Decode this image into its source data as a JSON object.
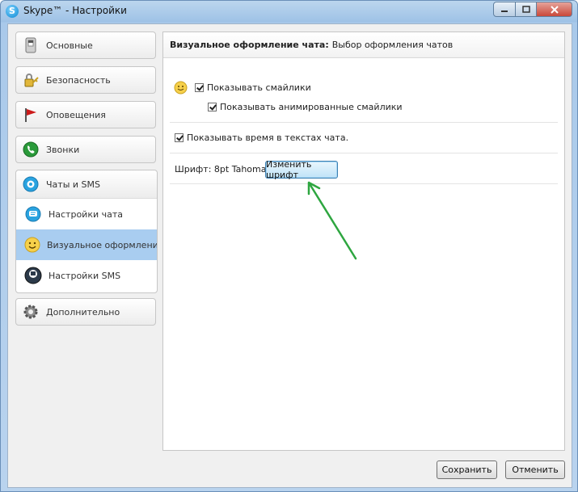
{
  "window": {
    "title": "Skype™ - Настройки",
    "app_icon_letter": "S"
  },
  "sidebar": {
    "items": [
      {
        "label": "Основные",
        "icon": "switch-icon"
      },
      {
        "label": "Безопасность",
        "icon": "lock-key-icon"
      },
      {
        "label": "Оповещения",
        "icon": "flag-icon"
      },
      {
        "label": "Звонки",
        "icon": "phone-icon"
      }
    ],
    "group": {
      "label": "Чаты и SMS",
      "icon": "chat-bubble-icon",
      "subitems": [
        {
          "label": "Настройки чата",
          "icon": "chat-settings-icon"
        },
        {
          "label": "Визуальное оформление чата",
          "icon": "smiley-icon",
          "active": true
        },
        {
          "label": "Настройки SMS",
          "icon": "sms-phone-icon"
        }
      ]
    },
    "advanced": {
      "label": "Дополнительно",
      "icon": "gear-icon"
    }
  },
  "panel": {
    "header_bold": "Визуальное оформление чата:",
    "header_text": "Выбор оформления чатов",
    "show_smileys": {
      "label": "Показывать смайлики",
      "checked": true
    },
    "show_animated": {
      "label": "Показывать анимированные смайлики",
      "checked": true
    },
    "show_time": {
      "label": "Показывать время в текстах чата.",
      "checked": true
    },
    "font_label": "Шрифт: 8pt Tahoma",
    "change_font_button": "Изменить шрифт"
  },
  "footer": {
    "save_button": "Сохранить",
    "cancel_button": "Отменить"
  },
  "colors": {
    "accent": "#a9cdf0",
    "annotation_arrow": "#2ea640"
  }
}
